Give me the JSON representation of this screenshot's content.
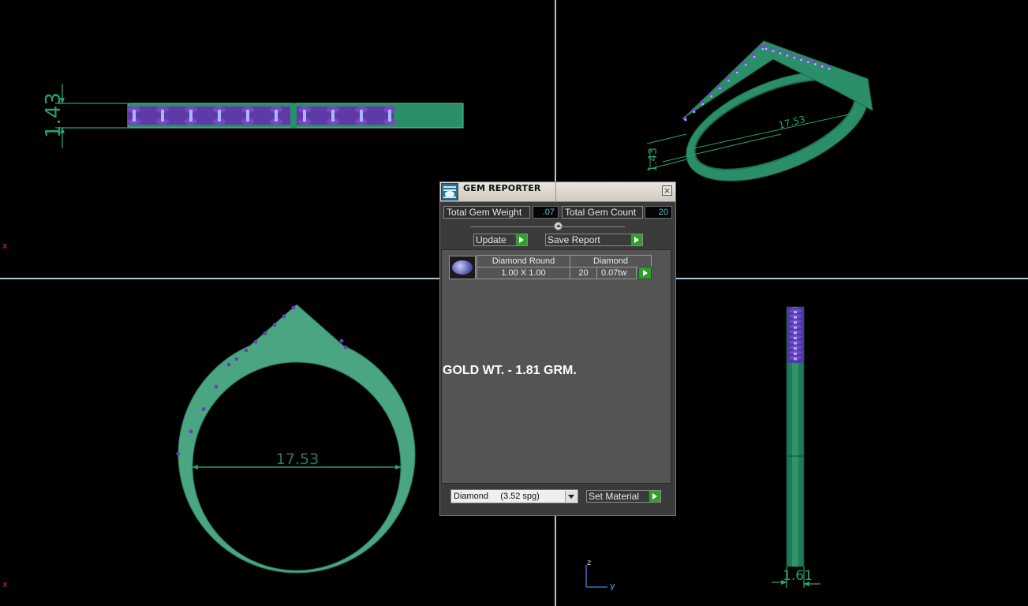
{
  "viewport": {
    "top_view": {
      "dimension": "1.43"
    },
    "perspective_view": {
      "dimension_long": "17.53",
      "dimension_short": "1.43"
    },
    "front_view": {
      "dimension": "17.53"
    },
    "side_view": {
      "dimension": "1.61"
    },
    "axis_marks": {
      "top_left": "x",
      "bottom_left": "x",
      "z": "z",
      "y": "y"
    }
  },
  "colors": {
    "background": "#000000",
    "divider": "#a8c8d8",
    "ring_metal": "#2a8f68",
    "ring_metal_light": "#4aa582",
    "gem_purple": "#7a45c8",
    "gem_light": "#a8b8ff",
    "dimension": "#2aa070",
    "accent_green": "#2f9e2f",
    "value_text": "#4fc0d0"
  },
  "gem_reporter": {
    "title": "GEM REPORTER",
    "close_label": "×",
    "total_weight_label": "Total Gem Weight",
    "total_weight_value": ".07",
    "total_count_label": "Total Gem Count",
    "total_count_value": "20",
    "update_label": "Update",
    "save_report_label": "Save Report",
    "gem_row": {
      "shape": "Diamond Round",
      "size": "1.00 X 1.00",
      "material": "Diamond",
      "count": "20",
      "weight": "0.07tw"
    },
    "gold_weight": "GOLD WT. - 1.81 GRM.",
    "material_select": "Diamond     (3.52 spg)",
    "set_material_label": "Set Material"
  }
}
